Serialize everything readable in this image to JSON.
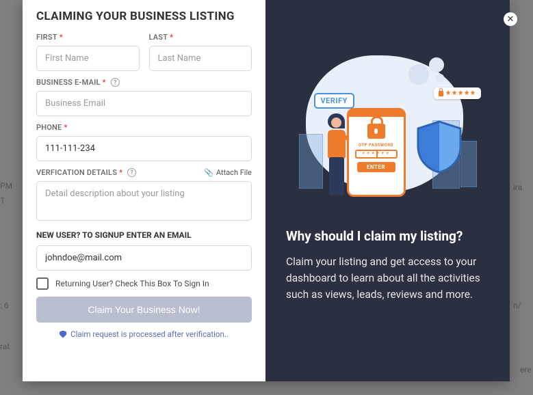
{
  "backdrop": {
    "t1": "PM",
    "t2": "1",
    "t3": ": 6",
    "t4": "ira",
    "t5": "n/",
    "t6": "rat",
    "t7": "ere"
  },
  "form": {
    "title": "CLAIMING YOUR BUSINESS LISTING",
    "first": {
      "label": "FIRST",
      "placeholder": "First Name"
    },
    "last": {
      "label": "LAST",
      "placeholder": "Last Name"
    },
    "email": {
      "label": "BUSINESS E-MAIL",
      "placeholder": "Business Email"
    },
    "phone": {
      "label": "PHONE",
      "value": "111-111-234"
    },
    "details": {
      "label": "VERFICATION DETAILS",
      "placeholder": "Detail description about your listing"
    },
    "attach_label": "Attach File",
    "newuser_label": "NEW USER? TO SIGNUP ENTER AN EMAIL",
    "signup_email": {
      "value": "johndoe@mail.com"
    },
    "returning_label": "Returning User? Check This Box To Sign In",
    "submit_label": "Claim Your Business Now!",
    "note": "Claim request is processed after verification.."
  },
  "promo": {
    "heading": "Why should I claim my listing?",
    "body": "Claim your listing and get access to your dashboard to learn about all the activities such as views, leads, reviews and more.",
    "verify_tag": "VERIFY",
    "otp_label": "OTP PASSWORD",
    "enter_label": "ENTER",
    "pw_stars": "★★★★★"
  }
}
